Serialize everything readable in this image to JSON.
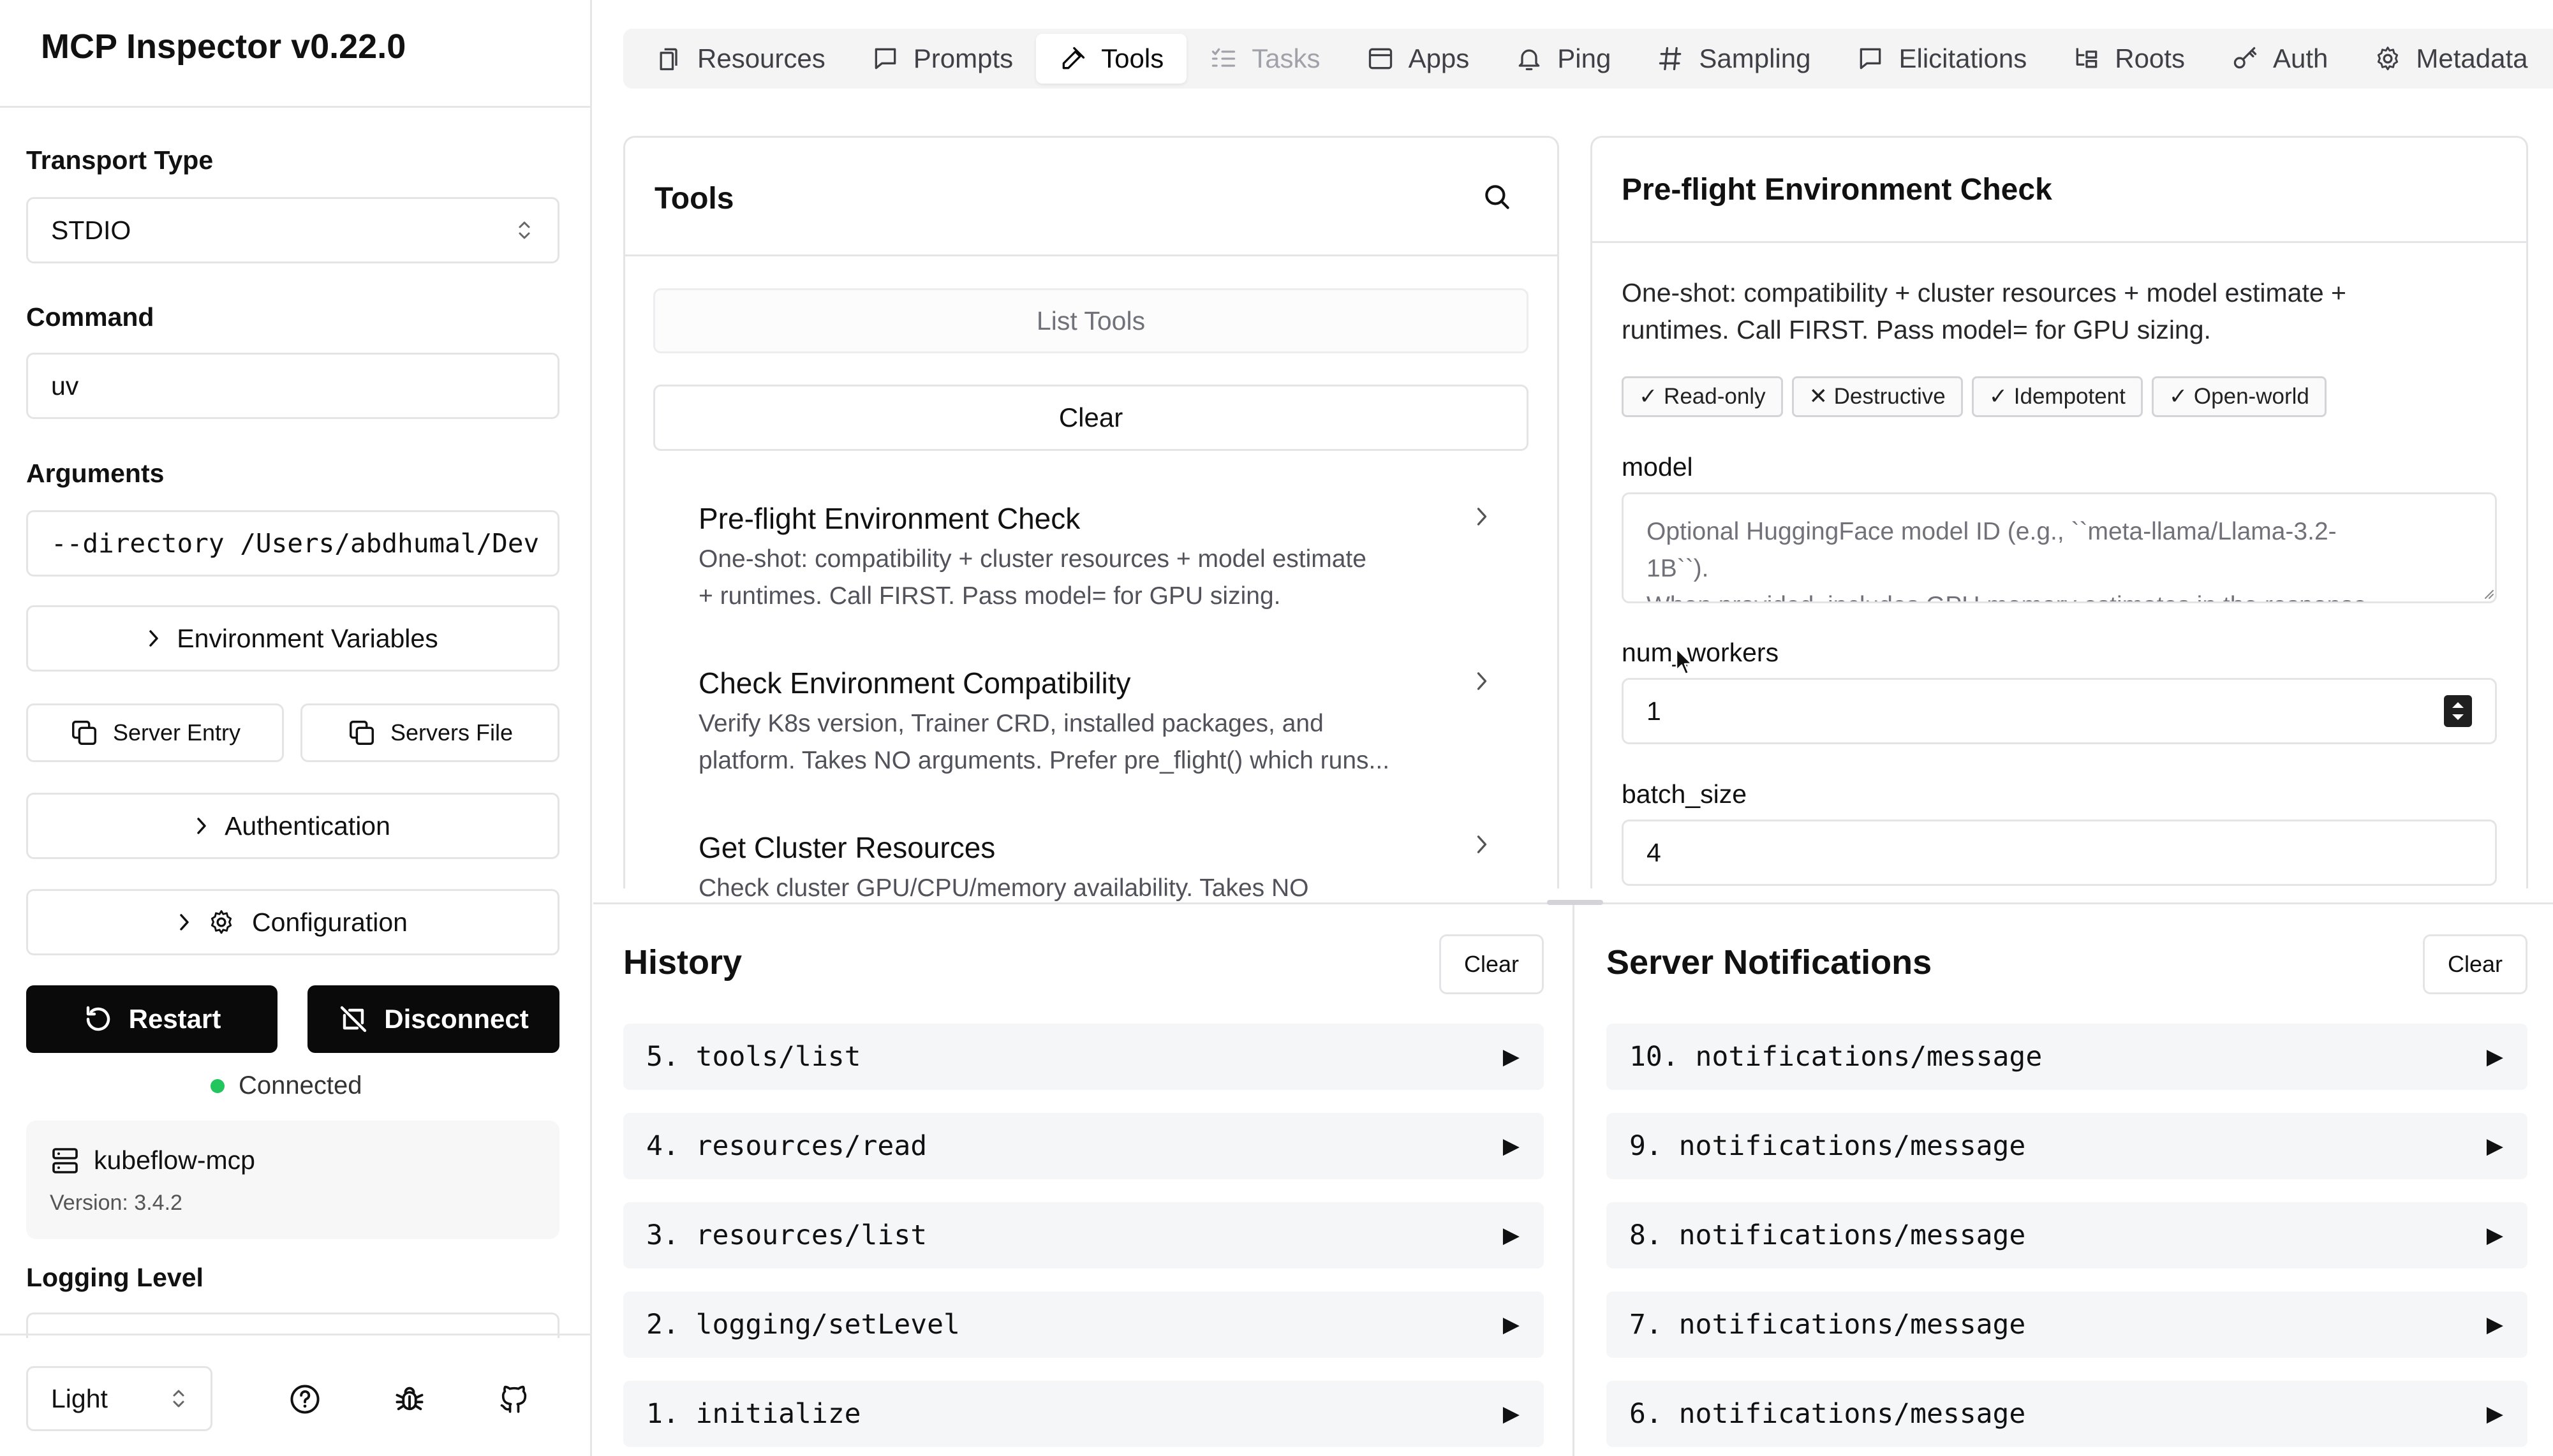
{
  "app": {
    "title": "MCP Inspector v0.22.0"
  },
  "sidebar": {
    "transport_label": "Transport Type",
    "transport_value": "STDIO",
    "command_label": "Command",
    "command_value": "uv",
    "arguments_label": "Arguments",
    "arguments_value": "--directory /Users/abdhumal/Dev",
    "env_vars_label": "Environment Variables",
    "server_entry_label": "Server Entry",
    "servers_file_label": "Servers File",
    "auth_label": "Authentication",
    "config_label": "Configuration",
    "restart_label": "Restart",
    "disconnect_label": "Disconnect",
    "status_text": "Connected",
    "status_color": "#22c55e",
    "server_name": "kubeflow-mcp",
    "server_version": "Version: 3.4.2",
    "logging_label": "Logging Level",
    "theme_value": "Light"
  },
  "tabs": [
    {
      "label": "Resources",
      "icon": "file-icon"
    },
    {
      "label": "Prompts",
      "icon": "message-icon"
    },
    {
      "label": "Tools",
      "icon": "hammer-icon"
    },
    {
      "label": "Tasks",
      "icon": "list-icon"
    },
    {
      "label": "Apps",
      "icon": "window-icon"
    },
    {
      "label": "Ping",
      "icon": "bell-icon"
    },
    {
      "label": "Sampling",
      "icon": "hash-icon"
    },
    {
      "label": "Elicitations",
      "icon": "message-icon"
    },
    {
      "label": "Roots",
      "icon": "folder-tree-icon"
    },
    {
      "label": "Auth",
      "icon": "key-icon"
    },
    {
      "label": "Metadata",
      "icon": "gear-icon"
    }
  ],
  "tools_panel": {
    "title": "Tools",
    "list_tools_label": "List Tools",
    "clear_label": "Clear",
    "items": [
      {
        "title": "Pre-flight Environment Check",
        "desc1": "One-shot: compatibility + cluster resources + model estimate",
        "desc2": "+ runtimes. Call FIRST. Pass model= for GPU sizing."
      },
      {
        "title": "Check Environment Compatibility",
        "desc1": "Verify K8s version, Trainer CRD, installed packages, and",
        "desc2": "platform. Takes NO arguments. Prefer pre_flight() which runs..."
      },
      {
        "title": "Get Cluster Resources",
        "desc1": "Check cluster GPU/CPU/memory availability. Takes NO",
        "desc2": ""
      }
    ]
  },
  "detail_panel": {
    "title": "Pre-flight Environment Check",
    "desc1": "One-shot: compatibility + cluster resources + model estimate +",
    "desc2": "runtimes. Call FIRST. Pass model= for GPU sizing.",
    "badges": [
      "✓ Read-only",
      "✕ Destructive",
      "✓ Idempotent",
      "✓ Open-world"
    ],
    "model_label": "model",
    "model_placeholder1": "Optional HuggingFace model ID (e.g., ``meta-llama/Llama-3.2-",
    "model_placeholder2": "1B``).",
    "model_placeholder3": "When provided, includes GPU memory estimates in the response.",
    "num_workers_label": "num_workers",
    "num_workers_value": "1",
    "batch_size_label": "batch_size",
    "batch_size_value": "4"
  },
  "history": {
    "title": "History",
    "clear_label": "Clear",
    "items": [
      "5. tools/list",
      "4. resources/read",
      "3. resources/list",
      "2. logging/setLevel",
      "1. initialize"
    ]
  },
  "notifications": {
    "title": "Server Notifications",
    "clear_label": "Clear",
    "items": [
      "10. notifications/message",
      "9. notifications/message",
      "8. notifications/message",
      "7. notifications/message",
      "6. notifications/message"
    ]
  },
  "expand_glyph": "▶"
}
